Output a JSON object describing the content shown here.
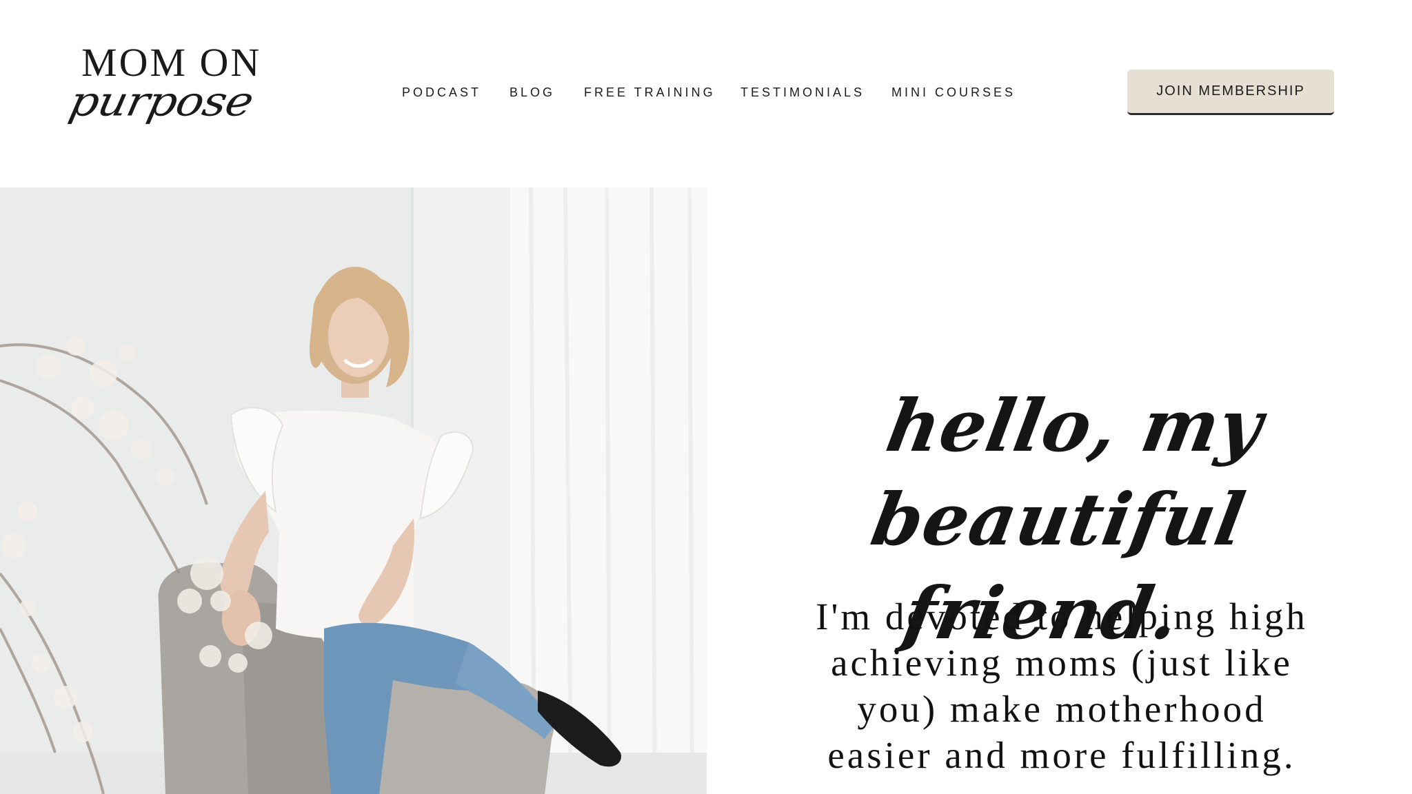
{
  "brand": {
    "logo_line1": "MOM ON",
    "logo_line2": "purpose"
  },
  "nav": {
    "items": [
      {
        "label": "PODCAST"
      },
      {
        "label": "BLOG"
      },
      {
        "label": "FREE TRAINING"
      },
      {
        "label": "TESTIMONIALS"
      },
      {
        "label": "MINI COURSES"
      }
    ],
    "cta_label": "JOIN MEMBERSHIP"
  },
  "hero": {
    "greeting": "hello, my beautiful friend.",
    "lede": "I'm devoted to helping high achieving moms (just like you) make motherhood easier and more fulfilling.",
    "photo_alt": "Smiling woman in a white ruffled top and blue jeans sitting on a gray armchair beside a blossom branch"
  },
  "colors": {
    "background": "#ffffff",
    "text": "#111111",
    "cta_background": "#e6dfd4",
    "cta_border": "#2a2a2a"
  }
}
